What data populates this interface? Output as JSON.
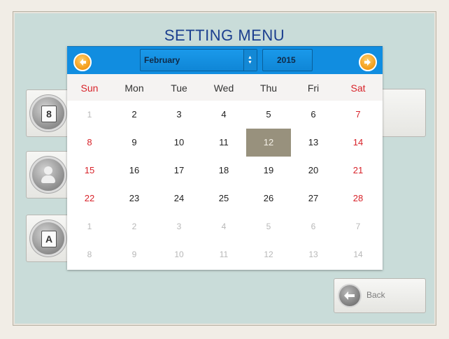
{
  "title": "SETTING MENU",
  "calendar": {
    "month": "February",
    "year": "2015",
    "weekdays": [
      {
        "label": "Sun",
        "weekend": true
      },
      {
        "label": "Mon",
        "weekend": false
      },
      {
        "label": "Tue",
        "weekend": false
      },
      {
        "label": "Wed",
        "weekend": false
      },
      {
        "label": "Thu",
        "weekend": false
      },
      {
        "label": "Fri",
        "weekend": false
      },
      {
        "label": "Sat",
        "weekend": true
      }
    ],
    "selected_day": 12,
    "weeks": [
      [
        {
          "d": "1",
          "m": "out"
        },
        {
          "d": "2",
          "m": "cur"
        },
        {
          "d": "3",
          "m": "cur"
        },
        {
          "d": "4",
          "m": "cur"
        },
        {
          "d": "5",
          "m": "cur"
        },
        {
          "d": "6",
          "m": "cur"
        },
        {
          "d": "7",
          "m": "cur"
        }
      ],
      [
        {
          "d": "8",
          "m": "cur"
        },
        {
          "d": "9",
          "m": "cur"
        },
        {
          "d": "10",
          "m": "cur"
        },
        {
          "d": "11",
          "m": "cur"
        },
        {
          "d": "12",
          "m": "cur"
        },
        {
          "d": "13",
          "m": "cur"
        },
        {
          "d": "14",
          "m": "cur"
        }
      ],
      [
        {
          "d": "15",
          "m": "cur"
        },
        {
          "d": "16",
          "m": "cur"
        },
        {
          "d": "17",
          "m": "cur"
        },
        {
          "d": "18",
          "m": "cur"
        },
        {
          "d": "19",
          "m": "cur"
        },
        {
          "d": "20",
          "m": "cur"
        },
        {
          "d": "21",
          "m": "cur"
        }
      ],
      [
        {
          "d": "22",
          "m": "cur"
        },
        {
          "d": "23",
          "m": "cur"
        },
        {
          "d": "24",
          "m": "cur"
        },
        {
          "d": "25",
          "m": "cur"
        },
        {
          "d": "26",
          "m": "cur"
        },
        {
          "d": "27",
          "m": "cur"
        },
        {
          "d": "28",
          "m": "cur"
        }
      ],
      [
        {
          "d": "1",
          "m": "out"
        },
        {
          "d": "2",
          "m": "out"
        },
        {
          "d": "3",
          "m": "out"
        },
        {
          "d": "4",
          "m": "out"
        },
        {
          "d": "5",
          "m": "out"
        },
        {
          "d": "6",
          "m": "out"
        },
        {
          "d": "7",
          "m": "out"
        }
      ],
      [
        {
          "d": "8",
          "m": "out"
        },
        {
          "d": "9",
          "m": "out"
        },
        {
          "d": "10",
          "m": "out"
        },
        {
          "d": "11",
          "m": "out"
        },
        {
          "d": "12",
          "m": "out"
        },
        {
          "d": "13",
          "m": "out"
        },
        {
          "d": "14",
          "m": "out"
        }
      ]
    ]
  },
  "side_buttons": [
    {
      "icon": "calendar-icon",
      "glyph": "8"
    },
    {
      "icon": "user-icon",
      "glyph": ""
    },
    {
      "icon": "font-icon",
      "glyph": "A"
    }
  ],
  "back_label": "Back",
  "colors": {
    "header_blue": "#118de0",
    "weekend_red": "#d8232a",
    "selected_day_bg": "#98917d",
    "title_blue": "#1c3f8f"
  }
}
